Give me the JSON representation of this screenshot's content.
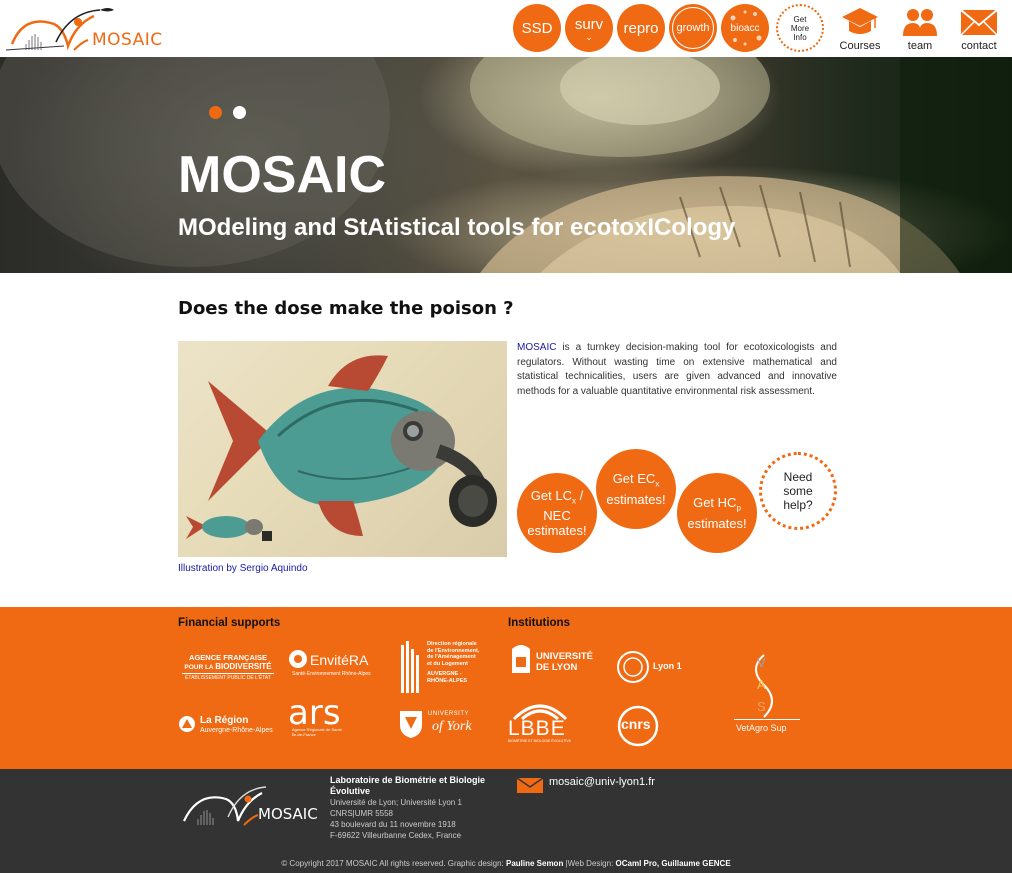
{
  "header": {
    "logo_text": "MOSAIC",
    "nav": [
      {
        "id": "ssd",
        "label": "SSD"
      },
      {
        "id": "surv",
        "label": "surv"
      },
      {
        "id": "repro",
        "label": "repro"
      },
      {
        "id": "growth",
        "label": "growth"
      },
      {
        "id": "bioacc",
        "label": "bioacc"
      },
      {
        "id": "more",
        "label_lines": [
          "Get",
          "More",
          "Info"
        ]
      }
    ],
    "icons": [
      {
        "id": "courses",
        "label": "Courses",
        "icon": "graduation-cap-icon"
      },
      {
        "id": "team",
        "label": "team",
        "icon": "people-icon"
      },
      {
        "id": "contact",
        "label": "contact",
        "icon": "envelope-icon"
      }
    ]
  },
  "hero": {
    "title": "MOSAIC",
    "subtitle": "MOdeling and StAtistical tools for ecotoxICology",
    "slide_active": 1,
    "slide_count": 2
  },
  "main": {
    "heading": "Does the dose make the poison ?",
    "caption": "Illustration by Sergio Aquindo",
    "intro_brand": "MOSAIC",
    "intro_text": " is a turnkey decision-making tool for ecotoxicologists and regulators. Without wasting time on extensive mathematical and statistical technicalities, users are given advanced and innovative methods for a valuable quantitative environmental risk assessment.",
    "cta": {
      "lc": [
        "Get LC",
        "x",
        " /",
        "NEC",
        "estimates!"
      ],
      "ec": [
        "Get EC",
        "x",
        "estimates!"
      ],
      "hc": [
        "Get HC",
        "p",
        "estimates!"
      ],
      "help": [
        "Need",
        "some",
        "help?"
      ]
    }
  },
  "supports": {
    "financial_heading": "Financial supports",
    "institutions_heading": "Institutions",
    "logos": {
      "afb_line1": "AGENCE FRANÇAISE",
      "afb_line2a": "POUR LA",
      "afb_line2b": "BIODIVERSITÉ",
      "afb_line3": "ÉTABLISSEMENT PUBLIC DE L'ÉTAT",
      "envitera": "EnvitéRA",
      "envitera_sub": "Santé-Environnement Rhône-Alpes",
      "dreal": [
        "Direction régionale",
        "de l'Environnement,",
        "de l'Aménagement",
        "et du Logement"
      ],
      "dreal_region": [
        "AUVERGNE -",
        "RHÔNE-ALPES"
      ],
      "region_name": "La Région",
      "region_sub": "Auvergne-Rhône-Alpes",
      "ars": "ars",
      "ars_sub": [
        "Agence Régionale de Santé",
        "Île-de-France"
      ],
      "york_university": "UNIVERSITY",
      "york_of": "of York",
      "udl_line1": "UNIVERSITÉ",
      "udl_line2": "DE LYON",
      "lyon1": "Lyon 1",
      "lbbe": "LBBE",
      "lbbe_sub": "BIOMÉTRIE ET BIOLOGIE ÉVOLUTIVE",
      "cnrs": "cnrs",
      "vetagro_letters": [
        "V",
        "A",
        "S"
      ],
      "vetagro": "VetAgro",
      "vetagro_sup": " Sup"
    }
  },
  "footer": {
    "logo_text": "MOSAIC",
    "lab_title": "Laboratoire de Biométrie et Biologie Évolutive",
    "lab_lines": [
      "Université de Lyon; Université Lyon 1",
      "CNRS|UMR 5558",
      "43 boulevard du 11 novembre 1918",
      "F-69622 Villeurbanne Cedex, France"
    ],
    "email": "mosaic@univ-lyon1.fr",
    "copyright_text": "© Copyright 2017 MOSAIC All rights reserved. Graphic design: ",
    "graphic_designer": "Pauline Semon",
    "web_design_label": " |Web Design: ",
    "web_designers": "OCaml Pro, Guillaume GENCE"
  },
  "colors": {
    "accent": "#ef6a13",
    "footer_bg": "#333333",
    "link": "#1a1aa8"
  }
}
